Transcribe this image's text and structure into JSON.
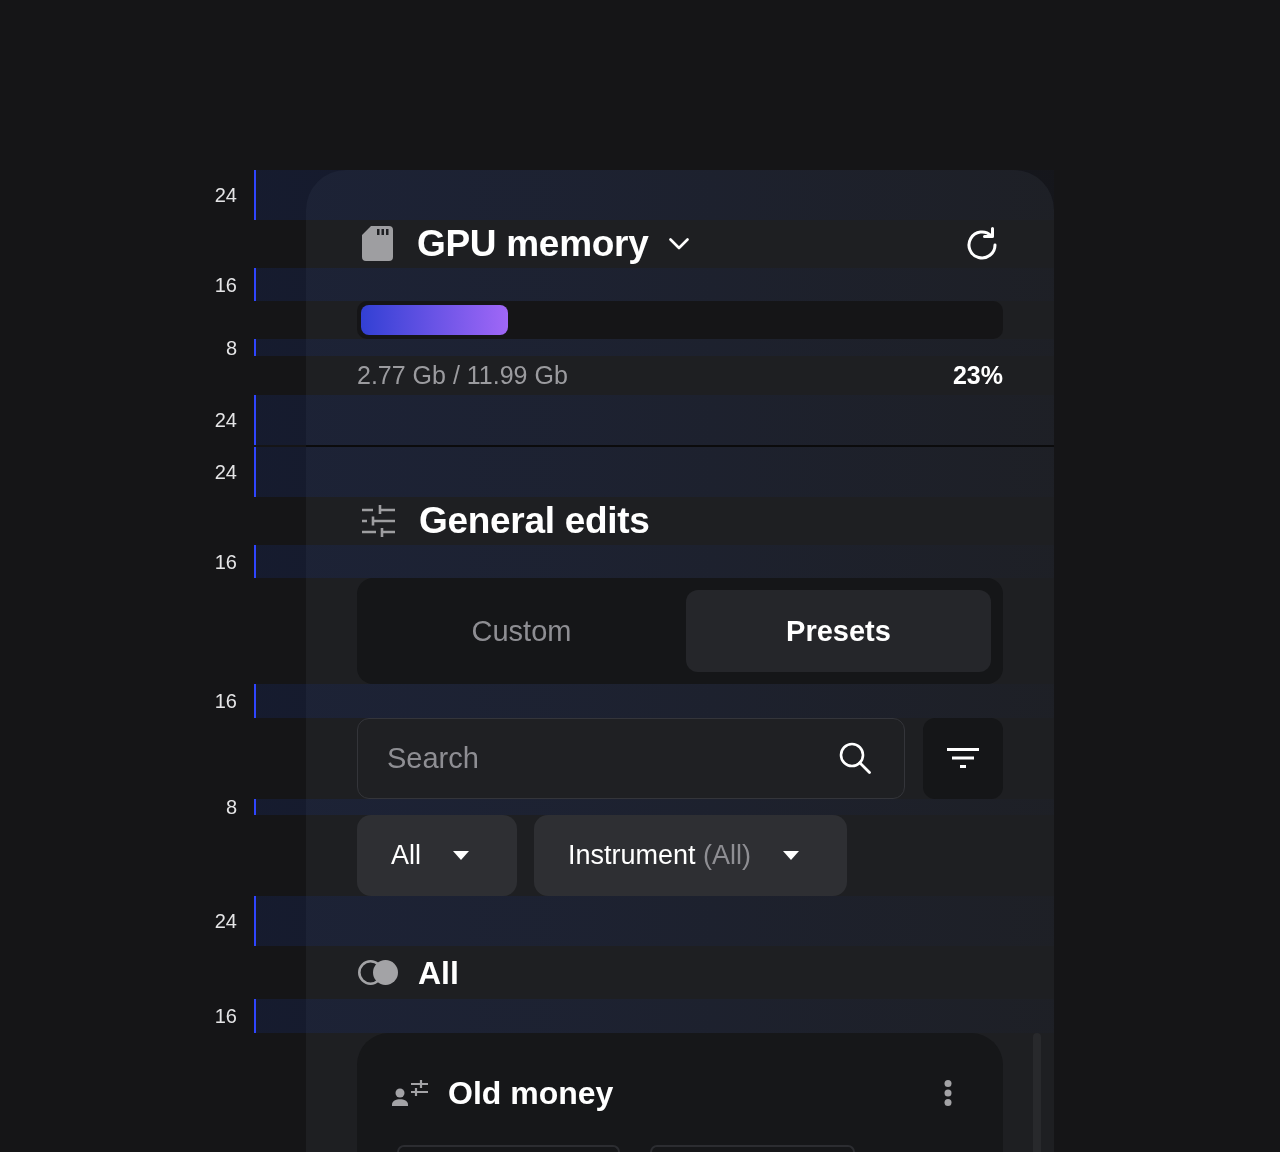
{
  "panel": {
    "rows": [
      {
        "kind": "spacer",
        "label": "24"
      },
      {
        "kind": "memory_header",
        "title": "GPU memory"
      },
      {
        "kind": "spacer",
        "label": "16"
      },
      {
        "kind": "meter",
        "level": 0.23
      },
      {
        "kind": "spacer",
        "label": "8"
      },
      {
        "kind": "readout",
        "usage": "2.77 Gb / 11.99 Gb",
        "percent": "23%"
      },
      {
        "kind": "spacer",
        "label": "24"
      },
      {
        "kind": "divider"
      },
      {
        "kind": "spacer",
        "label": "24"
      },
      {
        "kind": "section_title",
        "title": "General edits"
      },
      {
        "kind": "spacer",
        "label": "16"
      },
      {
        "kind": "segmented",
        "options": [
          {
            "label": "Custom",
            "selected": false
          },
          {
            "label": "Presets",
            "selected": true
          }
        ]
      },
      {
        "kind": "spacer",
        "label": "16"
      },
      {
        "kind": "search",
        "placeholder": "Search"
      },
      {
        "kind": "spacer",
        "label": "8"
      },
      {
        "kind": "filters",
        "dropdowns": [
          {
            "label": "All"
          },
          {
            "label": "Instrument",
            "value": "(All)"
          }
        ]
      },
      {
        "kind": "spacer",
        "label": "24"
      },
      {
        "kind": "group_title",
        "title": "All"
      },
      {
        "kind": "spacer",
        "label": "16"
      },
      {
        "kind": "preset_card",
        "title": "Old money"
      }
    ]
  }
}
